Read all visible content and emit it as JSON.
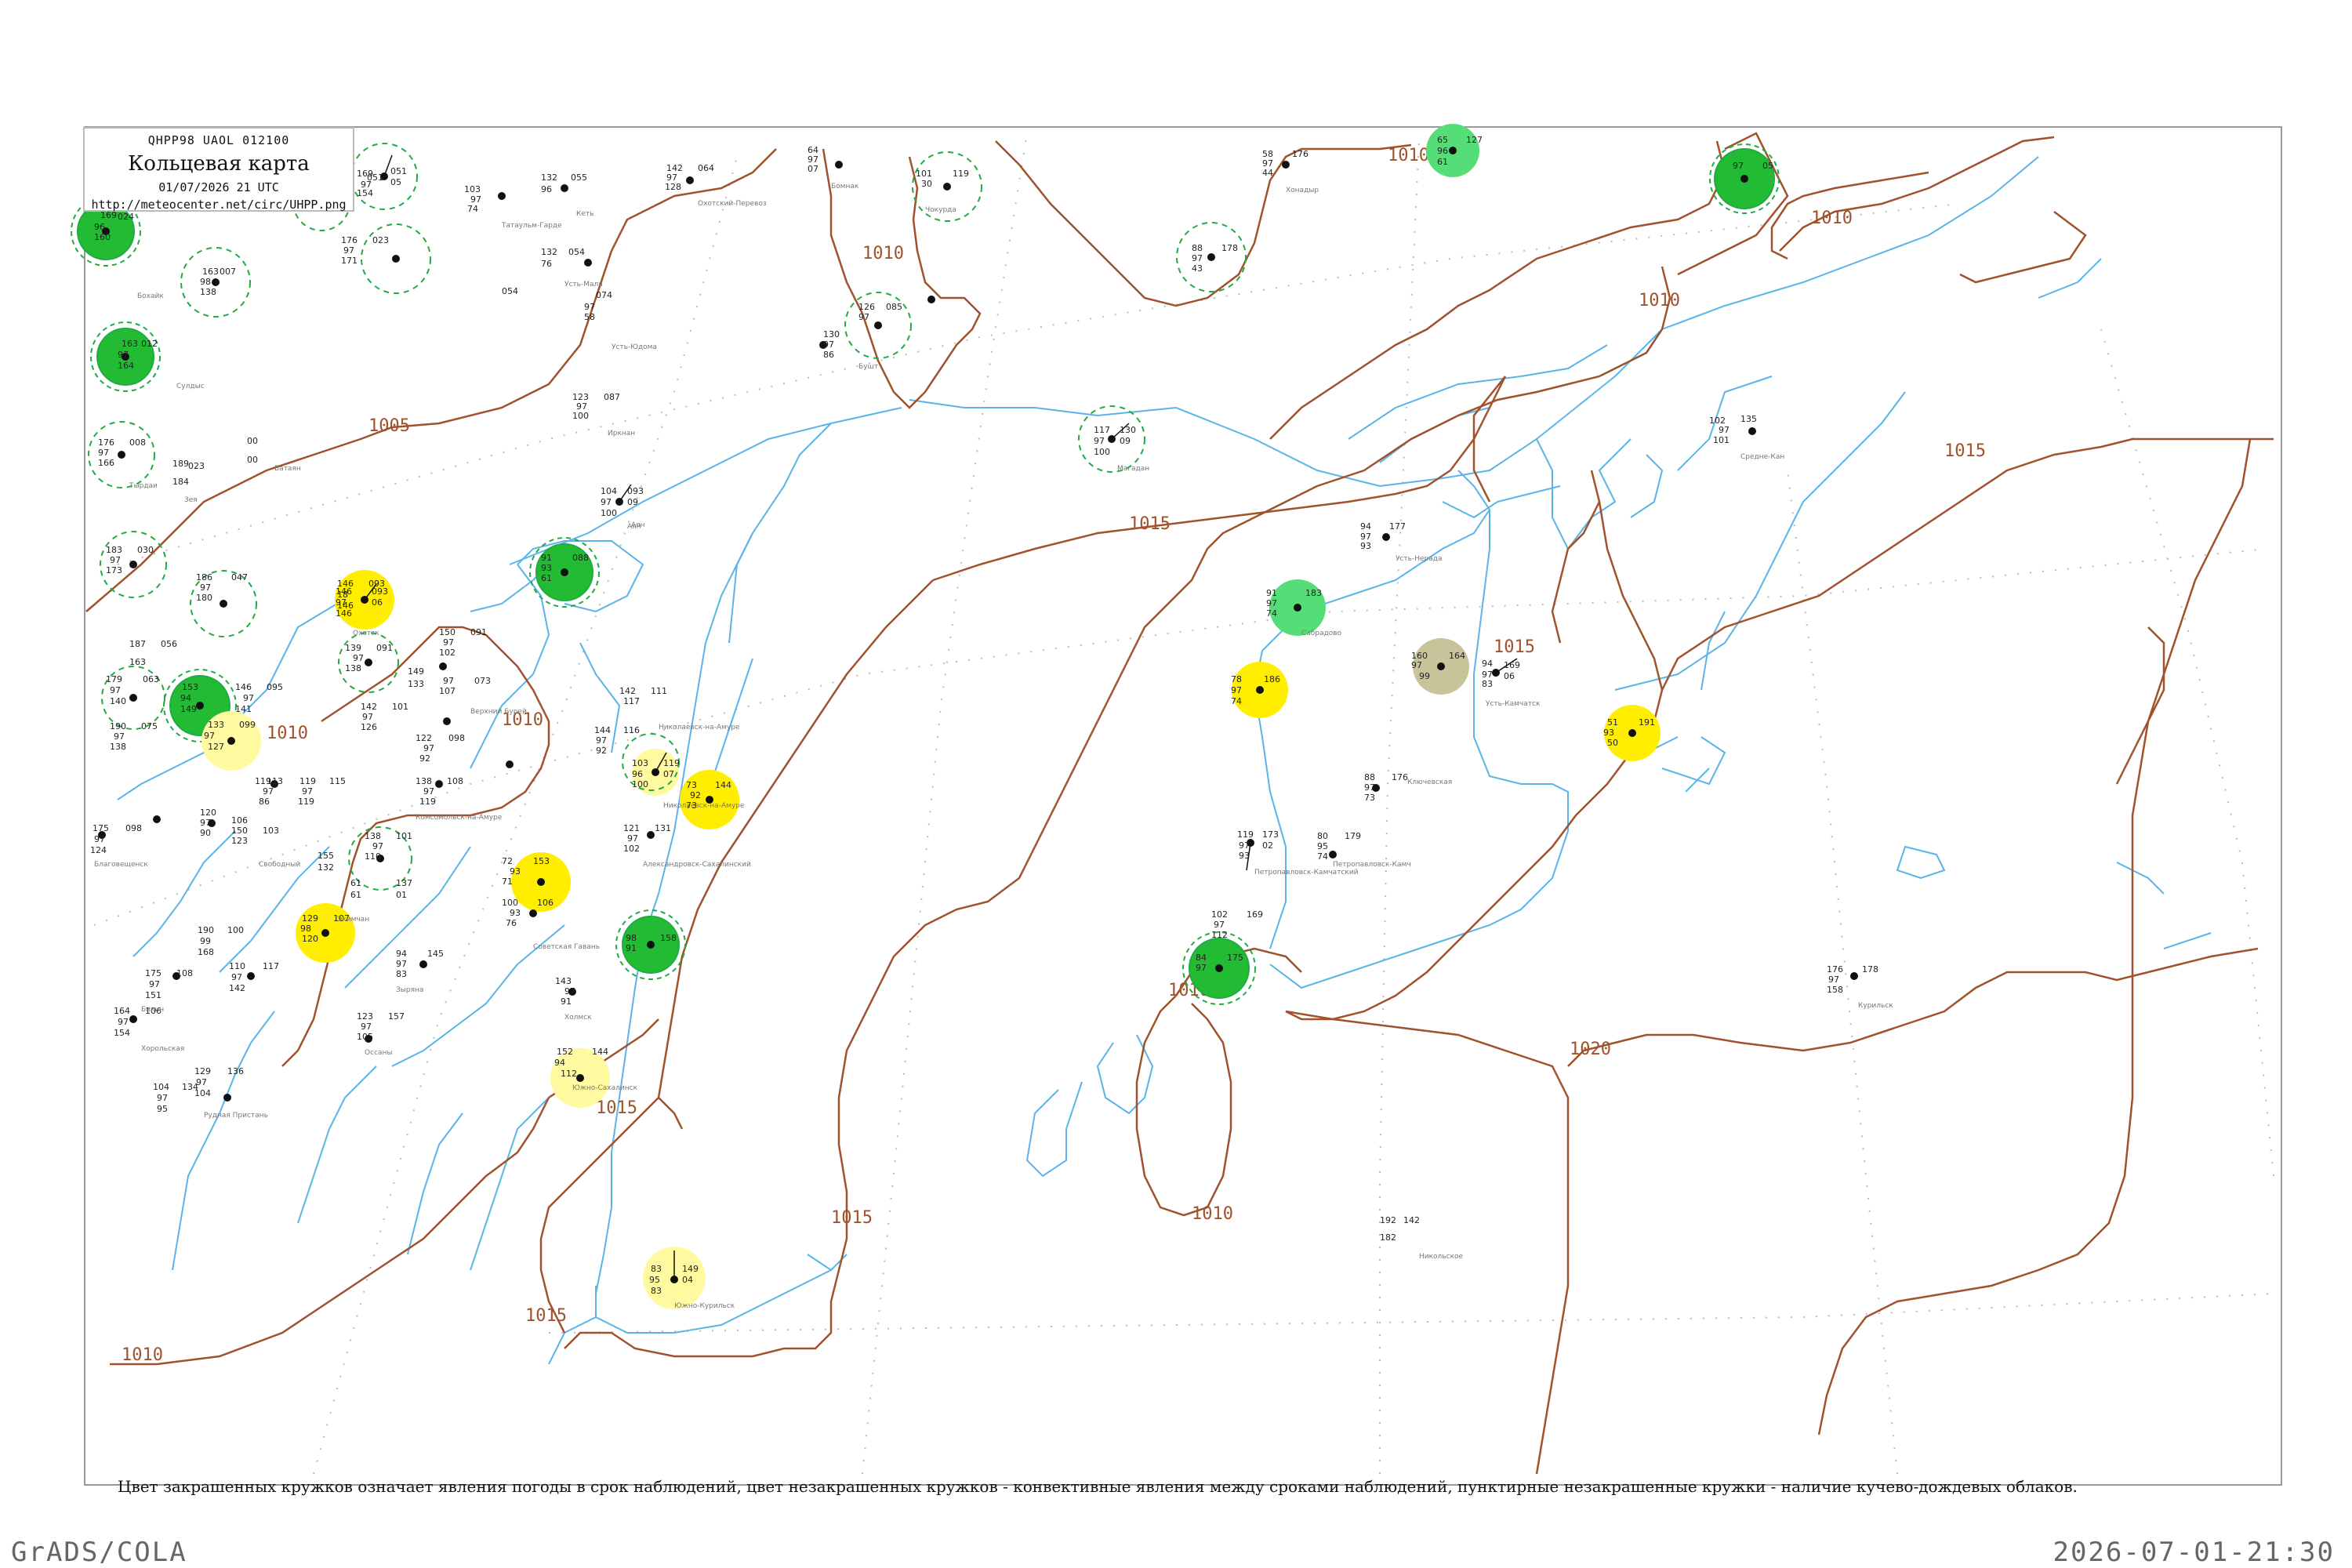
{
  "header": {
    "code_line": "QHPP98  UAOL  012100",
    "title": "Кольцевая карта",
    "datetime": "01/07/2026 21 UTC",
    "url": "http://meteocenter.net/circ/UHPP.png"
  },
  "caption": "Цвет закрашенных кружков означает явления погоды в срок наблюдений, цвет незакрашенных кружков - конвективные явления между сроками наблюдений, пунктирные незакрашенные кружки - наличие кучево-дождевых облаков.",
  "footer": {
    "left": "GrADS/COLA",
    "right": "2026-07-01-21:30"
  },
  "isobar_labels": [
    "1005",
    "1010",
    "1015",
    "1020"
  ],
  "colors": {
    "frame": "#999999",
    "isobar": "#a0522d",
    "river": "#5ab4e8",
    "coast": "#3a9ee0",
    "grid": "#bbbbbb",
    "green_dark": "#22bb33",
    "green_mid": "#55dd77",
    "green_light": "#99eeaa",
    "yellow": "#ffee00",
    "pale_yellow": "#fffaa0",
    "olive": "#c8c49a",
    "dashed_ring": "#22aa44"
  },
  "stations": [
    {
      "name": "Тигиль",
      "data": [
        "169",
        "97",
        "154",
        "051",
        "05"
      ]
    },
    {
      "name": "Усть-Камчатск",
      "data": [
        "94",
        "97",
        "83",
        "169",
        "06"
      ]
    },
    {
      "name": "Петропавловск-Камчатский",
      "data": [
        "119",
        "97",
        "93",
        "173",
        "02"
      ]
    },
    {
      "name": "Южно-Курильск",
      "data": [
        "83",
        "95",
        "83",
        "149",
        "04"
      ]
    },
    {
      "name": "Николаевск-на-Амуре",
      "data": [
        "103",
        "96",
        "100",
        "119",
        "07"
      ]
    },
    {
      "name": "Охотск",
      "data": [
        "146",
        "97",
        "146",
        "093",
        "06"
      ]
    },
    {
      "name": "Магадан",
      "data": [
        "117",
        "97",
        "100",
        "130",
        "09"
      ]
    },
    {
      "name": "Аян",
      "data": [
        "104",
        "97",
        "100",
        "093",
        "09"
      ]
    }
  ]
}
